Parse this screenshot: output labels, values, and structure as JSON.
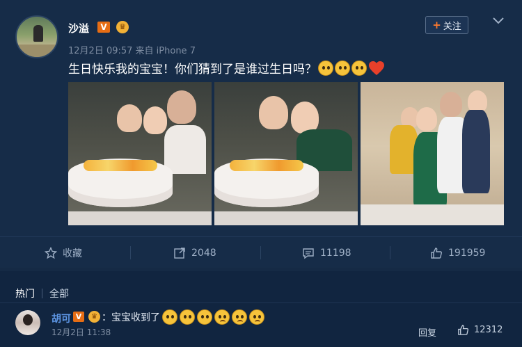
{
  "post": {
    "author": "沙溢",
    "verified_badge": "V",
    "meta": "12月2日 09:57 来自 iPhone 7",
    "follow_label": "关注",
    "text": "生日快乐我的宝宝！你们猜到了是谁过生日吗？",
    "text_emojis": [
      "thinking-emoji",
      "face-emoji",
      "face-emoji",
      "heart-emoji"
    ]
  },
  "actions": {
    "favorite": "收藏",
    "repost": "2048",
    "comment": "11198",
    "like": "191959"
  },
  "comments": {
    "tab_hot": "热门",
    "tab_all": "全部",
    "items": [
      {
        "author": "胡可",
        "badge": "V",
        "text": "：宝宝收到了",
        "time": "12月2日 11:38",
        "reply_label": "回复",
        "likes": "12312"
      }
    ]
  },
  "colors": {
    "background": "#152a45",
    "accent": "#ff7a2e",
    "link": "#5e97e6",
    "verified": "#e66d14"
  }
}
